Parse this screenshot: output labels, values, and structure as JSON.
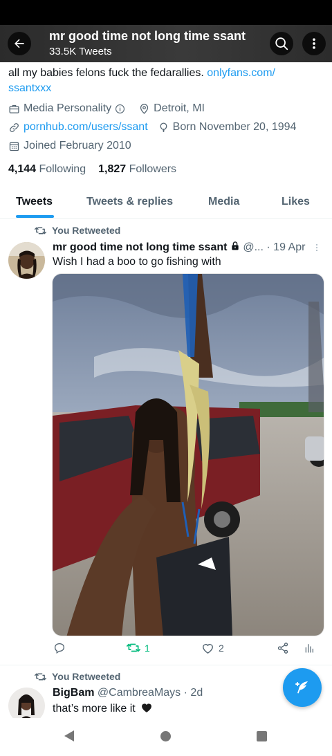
{
  "header": {
    "title": "mr good time not long time ssant",
    "subtitle": "33.5K Tweets"
  },
  "bio": {
    "text": "all my babies felons fuck the fedarallies. ",
    "link_line1": "onlyfans.com/",
    "link_line2": "ssantxxx"
  },
  "profile_meta": {
    "category": "Media Personality",
    "location": "Detroit, MI",
    "website": "pornhub.com/users/ssant",
    "born": "Born November 20, 1994",
    "joined": "Joined February 2010"
  },
  "stats": {
    "following_count": "4,144",
    "following_label": "Following",
    "followers_count": "1,827",
    "followers_label": "Followers"
  },
  "tabs": [
    {
      "label": "Tweets",
      "active": true
    },
    {
      "label": "Tweets & replies",
      "active": false
    },
    {
      "label": "Media",
      "active": false
    },
    {
      "label": "Likes",
      "active": false
    }
  ],
  "tweets": [
    {
      "retweet_label": "You Retweeted",
      "name": "mr good time not long time ssant",
      "handle": "@...",
      "time": "· 19 Apr",
      "text": "Wish I had a boo to go fishing with",
      "has_media": true,
      "retweets": "1",
      "likes": "2"
    },
    {
      "retweet_label": "You Retweeted",
      "name": "BigBam",
      "handle": "@CambreaMays",
      "time": "· 2d",
      "text": "that’s more like it"
    }
  ],
  "colors": {
    "accent": "#1d9bf0",
    "retweet_green": "#00ba7c",
    "muted_text": "#536471",
    "primary_text": "#0f1419"
  },
  "icons": {
    "back": "arrow-left-icon",
    "search": "search-icon",
    "more": "more-vertical-icon",
    "compose": "feather-icon",
    "reply": "comment-bubble-icon",
    "retweet": "retweet-icon",
    "like": "heart-icon",
    "share": "share-icon",
    "views": "bar-chart-icon"
  }
}
